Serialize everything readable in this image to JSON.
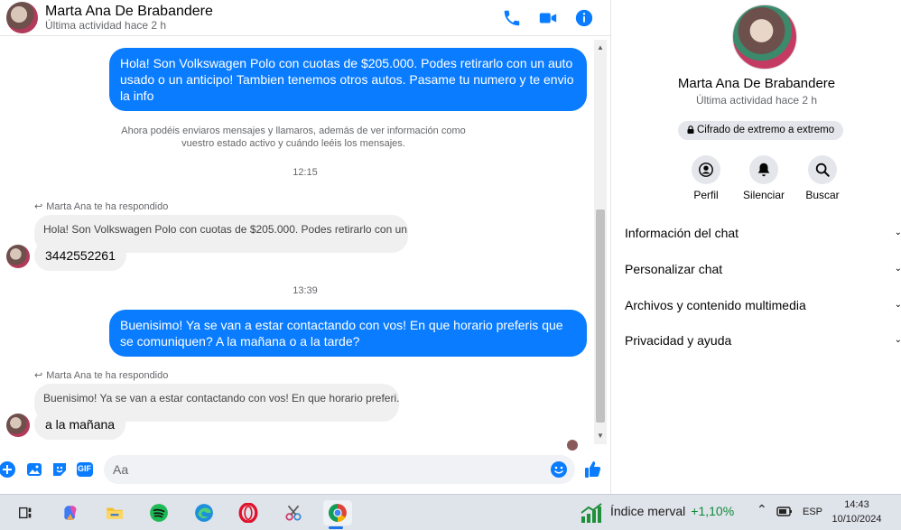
{
  "contact": {
    "name": "Marta Ana De Brabandere",
    "status": "Última actividad hace 2 h"
  },
  "header_icons": [
    "phone-icon",
    "video-icon",
    "info-icon"
  ],
  "messages": {
    "out1": "Hola! Son Volkswagen Polo con cuotas de $205.000. Podes retirarlo con un auto usado o un anticipo! Tambien tenemos otros autos. Pasame tu numero y te envio la info",
    "system": "Ahora podéis enviaros mensajes y llamaros, además de ver información como vuestro estado activo y cuándo leéis los mensajes.",
    "time1": "12:15",
    "reply_label1": "Marta Ana te ha respondido",
    "quote1": "Hola! Son Volkswagen Polo con cuotas de $205.000. Podes retirarlo con un...",
    "in1": "3442552261",
    "time2": "13:39",
    "out2": "Buenisimo! Ya se van a estar contactando con vos! En que horario preferis que se comuniquen? A la mañana o a la tarde?",
    "reply_label2": "Marta Ana te ha respondido",
    "quote2": "Buenisimo! Ya se van a estar contactando con vos! En que horario preferi...",
    "in2": "a la mañana"
  },
  "composer": {
    "placeholder": "Aa",
    "icons": [
      "add-icon",
      "image-icon",
      "sticker-icon",
      "gif-icon",
      "emoji-icon",
      "like-icon"
    ],
    "gif_label": "GIF"
  },
  "panel": {
    "name": "Marta Ana De Brabandere",
    "status": "Última actividad hace 2 h",
    "encryption": "Cifrado de extremo a extremo",
    "actions": [
      {
        "label": "Perfil",
        "icon": "profile-icon"
      },
      {
        "label": "Silenciar",
        "icon": "bell-icon"
      },
      {
        "label": "Buscar",
        "icon": "search-icon"
      }
    ],
    "sections": [
      "Información del chat",
      "Personalizar chat",
      "Archivos y contenido multimedia",
      "Privacidad y ayuda"
    ]
  },
  "taskbar": {
    "apps": [
      "task-view-icon",
      "copilot-icon",
      "file-explorer-icon",
      "spotify-icon",
      "edge-icon",
      "opera-icon",
      "snipping-tool-icon",
      "chrome-icon"
    ],
    "stock_name": "Índice merval",
    "stock_change": "+1,10%",
    "language": "ESP",
    "time": "14:43",
    "date": "10/10/2024"
  },
  "colors": {
    "accent": "#0a7cff",
    "bubble_in": "#f0f0f0",
    "stock_up": "#0f8a38"
  }
}
